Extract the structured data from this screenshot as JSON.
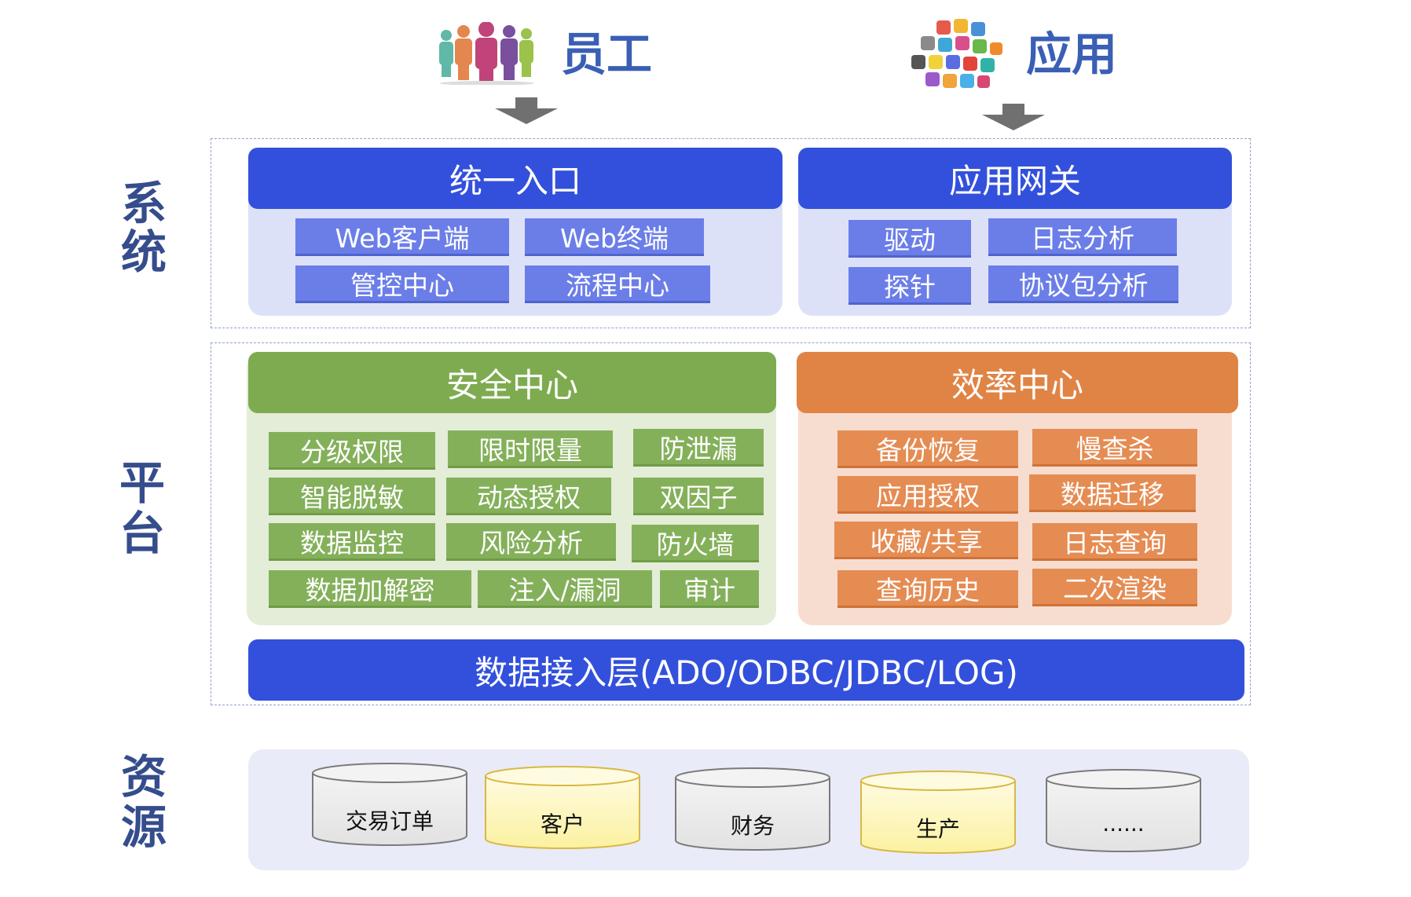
{
  "top": {
    "employees": {
      "label": "员工",
      "icon": "people-icon"
    },
    "apps": {
      "label": "应用",
      "icon": "app-cloud-icon"
    }
  },
  "side_labels": {
    "system": [
      "系",
      "统"
    ],
    "platform": [
      "平",
      "台"
    ],
    "resources": [
      "资",
      "源"
    ]
  },
  "system": {
    "portal": {
      "title": "统一入口",
      "items": [
        "Web客户端",
        "Web终端",
        "管控中心",
        "流程中心"
      ]
    },
    "gateway": {
      "title": "应用网关",
      "items": [
        "驱动",
        "日志分析",
        "探针",
        "协议包分析"
      ]
    }
  },
  "platform": {
    "security": {
      "title": "安全中心",
      "items": [
        "分级权限",
        "限时限量",
        "防泄漏",
        "智能脱敏",
        "动态授权",
        "双因子",
        "数据监控",
        "风险分析",
        "防火墙",
        "数据加解密",
        "注入/漏洞",
        "审计"
      ]
    },
    "efficiency": {
      "title": "效率中心",
      "items": [
        "备份恢复",
        "慢查杀",
        "应用授权",
        "数据迁移",
        "收藏/共享",
        "日志查询",
        "查询历史",
        "二次渲染"
      ]
    },
    "access_layer": "数据接入层(ADO/ODBC/JDBC/LOG)"
  },
  "resources": [
    {
      "label": "交易订单",
      "color": "#e2e2e2"
    },
    {
      "label": "客户",
      "color": "#fbf1a0"
    },
    {
      "label": "财务",
      "color": "#e2e2e2"
    },
    {
      "label": "生产",
      "color": "#fbf1a0"
    },
    {
      "label": "......",
      "color": "#e2e2e2"
    }
  ],
  "colors": {
    "blue_header": "#3350dc",
    "green_header": "#7eab50",
    "orange_header": "#e08445",
    "blue_body": "#dde1f8",
    "green_body": "#e3edd8",
    "orange_body": "#f7ddd0",
    "resource_bg": "#e9ebf8"
  }
}
